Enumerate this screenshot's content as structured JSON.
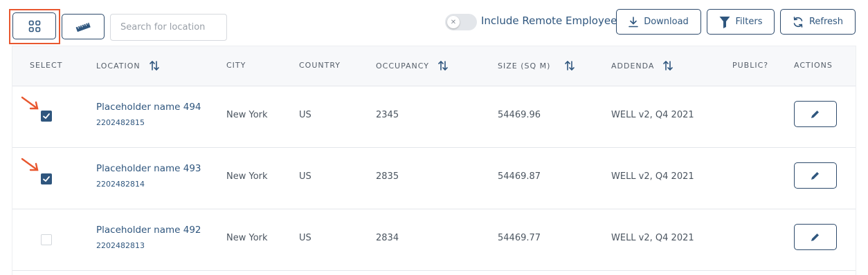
{
  "toolbar": {
    "grid_view_icon": "grid-four-squares-icon",
    "ruler_icon": "ruler-icon",
    "search_placeholder": "Search for location",
    "toggle_label": "Include Remote Employees",
    "toggle_on": false,
    "download_label": "Download",
    "filters_label": "Filters",
    "refresh_label": "Refresh"
  },
  "table": {
    "headers": {
      "select": "SELECT",
      "location": "LOCATION",
      "city": "CITY",
      "country": "COUNTRY",
      "occupancy": "OCCUPANCY",
      "size": "SIZE (SQ M)",
      "addenda": "ADDENDA",
      "public": "PUBLIC?",
      "actions": "ACTIONS"
    },
    "rows": [
      {
        "selected": true,
        "name": "Placeholder name 494",
        "id": "2202482815",
        "city": "New York",
        "country": "US",
        "occupancy": "2345",
        "size": "54469.96",
        "addenda": "WELL v2, Q4 2021",
        "public": ""
      },
      {
        "selected": true,
        "name": "Placeholder name 493",
        "id": "2202482814",
        "city": "New York",
        "country": "US",
        "occupancy": "2835",
        "size": "54469.87",
        "addenda": "WELL v2, Q4 2021",
        "public": ""
      },
      {
        "selected": false,
        "name": "Placeholder name 492",
        "id": "2202482813",
        "city": "New York",
        "country": "US",
        "occupancy": "2834",
        "size": "54469.77",
        "addenda": "WELL v2, Q4 2021",
        "public": ""
      }
    ]
  },
  "colors": {
    "accent": "#2f567e",
    "annotation_red": "#e8572f",
    "header_bg": "#f7f8fa",
    "border": "#e4e6ea"
  }
}
